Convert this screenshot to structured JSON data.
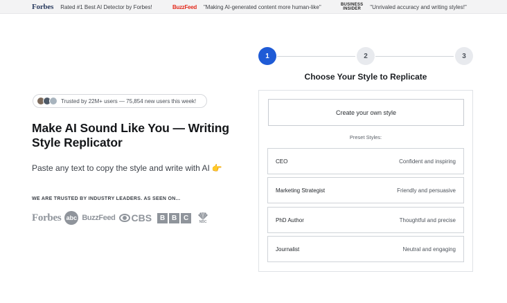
{
  "press_bar": {
    "forbes_logo": "Forbes",
    "forbes_quote": "Rated #1 Best AI Detector by Forbes!",
    "buzzfeed_logo": "BuzzFeed",
    "buzzfeed_quote": "\"Making AI-generated content more human-like\"",
    "bi_logo_line1": "BUSINESS",
    "bi_logo_line2": "INSIDER",
    "bi_quote": "\"Unrivaled accuracy and writing styles!\""
  },
  "hero": {
    "trust_text": "Trusted by 22M+ users — 75,854 new users this week!",
    "title": "Make AI Sound Like You — Writing Style Replicator",
    "subtitle": "Paste any text to copy the style and write with AI",
    "subtitle_emoji": "👉",
    "trusted_label": "WE ARE TRUSTED BY INDUSTRY LEADERS. AS SEEN ON...",
    "logos": {
      "forbes": "Forbes",
      "abc": "abc",
      "buzzfeed": "BuzzFeed",
      "cbs": "CBS",
      "bbc": [
        "B",
        "B",
        "C"
      ],
      "nbc": "NBC"
    }
  },
  "stepper": {
    "steps": [
      "1",
      "2",
      "3"
    ],
    "active_step": 1
  },
  "style_panel": {
    "title": "Choose Your Style to Replicate",
    "create_button": "Create your own style",
    "preset_label": "Preset Styles:",
    "presets": [
      {
        "name": "CEO",
        "description": "Confident and inspiring"
      },
      {
        "name": "Marketing Strategist",
        "description": "Friendly and persuasive"
      },
      {
        "name": "PhD Author",
        "description": "Thoughtful and precise"
      },
      {
        "name": "Journalist",
        "description": "Neutral and engaging"
      }
    ]
  },
  "colors": {
    "accent": "#1f5bd6",
    "forbes_brand": "#2d3e61",
    "buzzfeed_brand": "#e32a1c",
    "logo_gray": "#8f949b"
  }
}
